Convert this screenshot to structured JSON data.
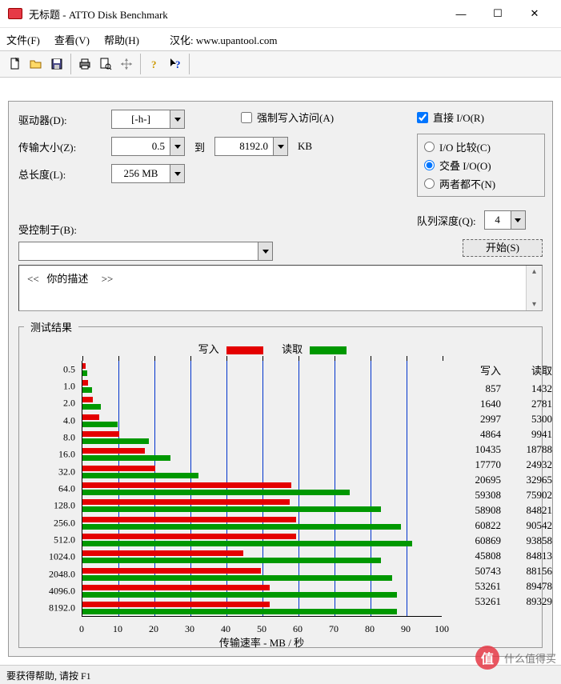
{
  "window": {
    "title": "无标题 - ATTO Disk Benchmark",
    "min": "—",
    "max": "☐",
    "close": "✕"
  },
  "menu": {
    "file": "文件(F)",
    "view": "查看(V)",
    "help": "帮助(H)",
    "localized": "汉化: www.upantool.com"
  },
  "form": {
    "drive_lbl": "驱动器(D):",
    "drive_val": "[-h-]",
    "xfer_lbl": "传输大小(Z):",
    "xfer_from": "0.5",
    "to_lbl": "到",
    "xfer_to": "8192.0",
    "xfer_unit": "KB",
    "len_lbl": "总长度(L):",
    "len_val": "256 MB",
    "force_lbl": "强制写入访问(A)",
    "force_checked": false,
    "direct_lbl": "直接 I/O(R)",
    "direct_checked": true,
    "radios": {
      "compare": "I/O 比较(C)",
      "overlap": "交叠 I/O(O)",
      "neither": "两者都不(N)",
      "selected": "overlap"
    },
    "queue_lbl": "队列深度(Q):",
    "queue_val": "4",
    "controlled_lbl": "受控制于(B):",
    "controlled_val": "",
    "start_lbl": "开始(S)",
    "desc_open": "<<",
    "desc_text": "你的描述",
    "desc_close": ">>"
  },
  "results": {
    "title": "测试结果",
    "legend_write": "写入",
    "legend_read": "读取",
    "x_title": "传输速率 - MB / 秒",
    "col_write": "写入",
    "col_read": "读取"
  },
  "chart_data": {
    "type": "bar",
    "categories": [
      "0.5",
      "1.0",
      "2.0",
      "4.0",
      "8.0",
      "16.0",
      "32.0",
      "64.0",
      "128.0",
      "256.0",
      "512.0",
      "1024.0",
      "2048.0",
      "4096.0",
      "8192.0"
    ],
    "series": [
      {
        "name": "写入",
        "color": "#e40000",
        "values": [
          857,
          1640,
          2997,
          4864,
          10435,
          17770,
          20695,
          59308,
          58908,
          60822,
          60869,
          45808,
          50743,
          53261,
          53261
        ],
        "values_mb": [
          0.84,
          1.6,
          2.93,
          4.75,
          10.19,
          17.35,
          20.21,
          57.92,
          57.53,
          59.4,
          59.44,
          44.73,
          49.55,
          52.01,
          52.01
        ]
      },
      {
        "name": "读取",
        "color": "#009800",
        "values": [
          1432,
          2781,
          5300,
          9941,
          18788,
          24932,
          32965,
          75902,
          84821,
          90542,
          93858,
          84813,
          88156,
          89478,
          89329
        ],
        "values_mb": [
          1.4,
          2.72,
          5.18,
          9.71,
          18.35,
          24.35,
          32.19,
          74.12,
          82.83,
          88.42,
          91.66,
          82.83,
          86.09,
          87.38,
          87.24
        ]
      }
    ],
    "xlabel": "传输速率 - MB / 秒",
    "ylabel": "",
    "xlim": [
      0,
      100
    ],
    "xticks": [
      0,
      10,
      20,
      30,
      40,
      50,
      60,
      70,
      80,
      90,
      100
    ]
  },
  "status": "要获得帮助, 请按 F1",
  "watermark": "什么值得买"
}
